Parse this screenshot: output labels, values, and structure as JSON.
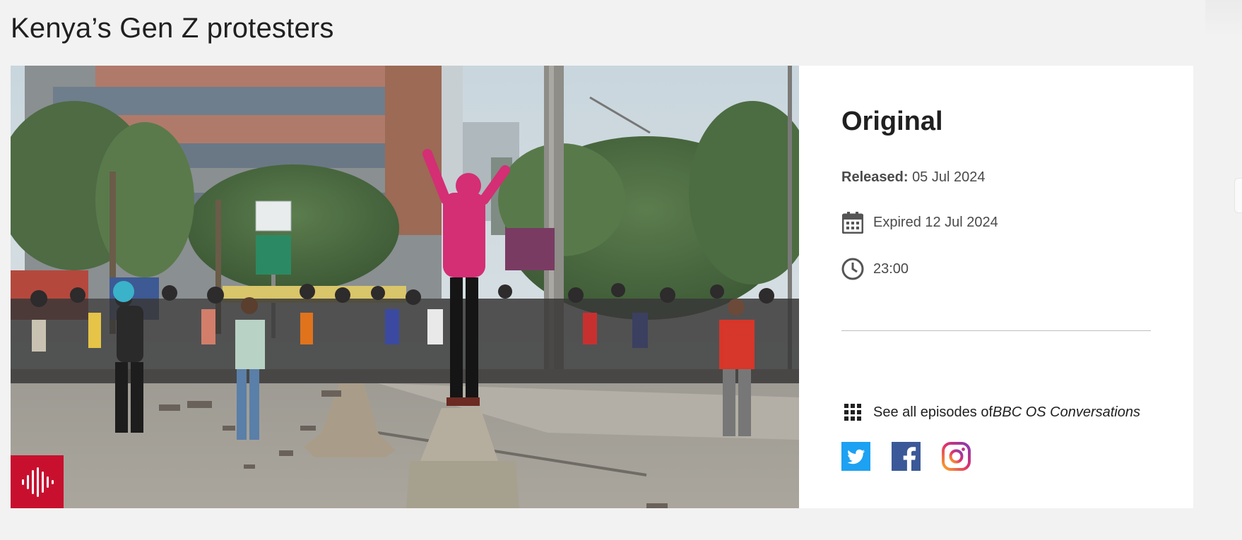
{
  "page": {
    "title": "Kenya’s Gen Z protesters"
  },
  "hero": {
    "icon": "audio-waveform-icon",
    "badge_color": "#c8102e"
  },
  "episode": {
    "version_title": "Original",
    "released_label": "Released:",
    "released_date": "05 Jul 2024",
    "availability": "Expired 12 Jul 2024",
    "availability_icon": "calendar-icon",
    "duration": "23:00",
    "duration_icon": "clock-icon"
  },
  "programme_link": {
    "prefix": "See all episodes of",
    "brand": "BBC OS Conversations",
    "icon": "grid-icon"
  },
  "share": [
    {
      "name": "Twitter",
      "icon": "twitter-icon",
      "color": "#1da1f2"
    },
    {
      "name": "Facebook",
      "icon": "facebook-icon",
      "color": "#3b5998"
    },
    {
      "name": "Instagram",
      "icon": "instagram-icon",
      "color": "#e1306c"
    }
  ]
}
